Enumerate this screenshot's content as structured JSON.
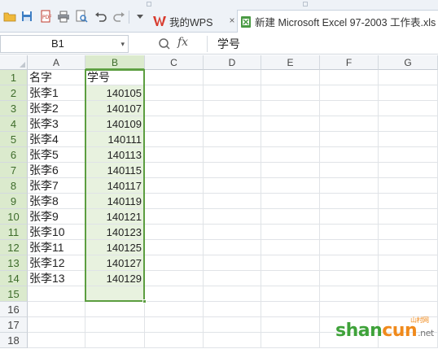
{
  "tabs": {
    "wps_label": "我的WPS",
    "wps_close": "×",
    "doc_label": "新建 Microsoft Excel 97-2003 工作表.xls"
  },
  "formula_bar": {
    "name_box": "B1",
    "name_dropdown": "▾",
    "fx_label": "fx",
    "content": "学号"
  },
  "columns": [
    "A",
    "B",
    "C",
    "D",
    "E",
    "F",
    "G"
  ],
  "selected_column": "B",
  "rows": [
    "1",
    "2",
    "3",
    "4",
    "5",
    "6",
    "7",
    "8",
    "9",
    "10",
    "11",
    "12",
    "13",
    "14",
    "15",
    "16",
    "17",
    "18"
  ],
  "selected_rows": [
    "1",
    "2",
    "3",
    "4",
    "5",
    "6",
    "7",
    "8",
    "9",
    "10",
    "11",
    "12",
    "13",
    "14",
    "15"
  ],
  "sheet": {
    "header": [
      "名字",
      "学号"
    ],
    "data": [
      [
        "张李1",
        "140105"
      ],
      [
        "张李2",
        "140107"
      ],
      [
        "张李3",
        "140109"
      ],
      [
        "张李4",
        "140111"
      ],
      [
        "张李5",
        "140113"
      ],
      [
        "张李6",
        "140115"
      ],
      [
        "张李7",
        "140117"
      ],
      [
        "张李8",
        "140119"
      ],
      [
        "张李9",
        "140121"
      ],
      [
        "张李10",
        "140123"
      ],
      [
        "张李11",
        "140125"
      ],
      [
        "张李12",
        "140127"
      ],
      [
        "张李13",
        "140129"
      ]
    ]
  },
  "watermark": {
    "part1": "shan",
    "part2": "cun",
    "suffix": ".net",
    "cn": "山村网"
  },
  "colors": {
    "selection": "#5c9e40",
    "selection_fill": "#e8f2df",
    "header_selected": "#dbeacd",
    "wps_red": "#d83b2e"
  }
}
